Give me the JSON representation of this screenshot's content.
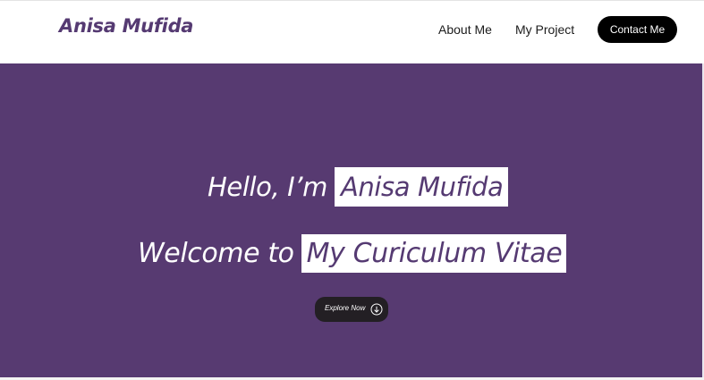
{
  "nav": {
    "brand": "Anisa Mufida",
    "links": [
      {
        "label": "About Me"
      },
      {
        "label": "My Project"
      }
    ],
    "contact_label": "Contact Me"
  },
  "hero": {
    "greeting_prefix": "Hello, I’m",
    "greeting_name": "Anisa Mufida",
    "welcome_prefix": "Welcome to",
    "welcome_highlight": "My Curiculum Vitae",
    "explore_label": "Explore Now",
    "explore_icon": "arrow-down-circle-icon"
  },
  "colors": {
    "brand_purple": "#573a71",
    "highlight_bg": "#ffffff",
    "button_dark": "#000000"
  }
}
